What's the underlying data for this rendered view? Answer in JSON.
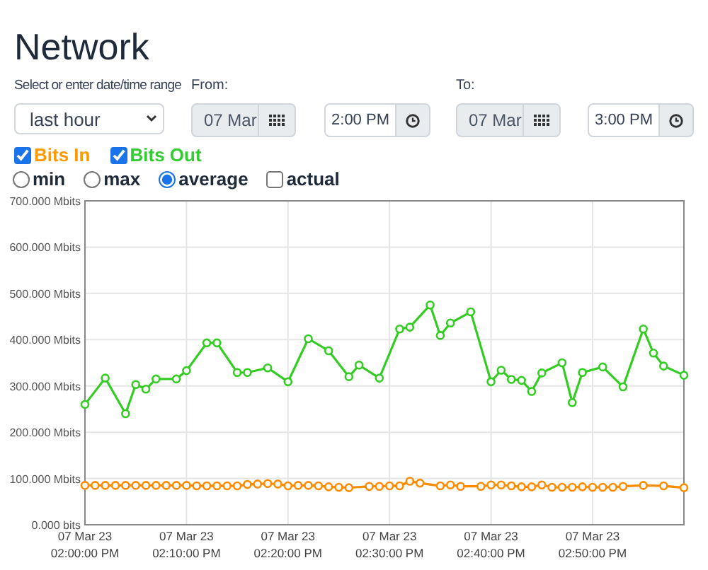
{
  "page": {
    "title": "Network"
  },
  "range": {
    "label": "Select or enter date/time range",
    "value": "last hour"
  },
  "from": {
    "label": "From:",
    "date": "07 Mar",
    "time": "2:00 PM"
  },
  "to": {
    "label": "To:",
    "date": "07 Mar",
    "time": "3:00 PM"
  },
  "series_toggles": [
    {
      "label": "Bits In",
      "checked": true,
      "color": "#ff9900"
    },
    {
      "label": "Bits Out",
      "checked": true,
      "color": "#33cc33"
    }
  ],
  "modes": [
    {
      "kind": "radio",
      "label": "min",
      "selected": false
    },
    {
      "kind": "radio",
      "label": "max",
      "selected": false
    },
    {
      "kind": "radio",
      "label": "average",
      "selected": true
    },
    {
      "kind": "checkbox",
      "label": "actual",
      "checked": false
    }
  ],
  "chart_data": {
    "type": "line",
    "grid": true,
    "ylim": [
      0,
      700
    ],
    "yticks": [
      {
        "value": 0,
        "label": "0.000 bits"
      },
      {
        "value": 100,
        "label": "100.000 Mbits"
      },
      {
        "value": 200,
        "label": "200.000 Mbits"
      },
      {
        "value": 300,
        "label": "300.000 Mbits"
      },
      {
        "value": 400,
        "label": "400.000 Mbits"
      },
      {
        "value": 500,
        "label": "500.000 Mbits"
      },
      {
        "value": 600,
        "label": "600.000 Mbits"
      },
      {
        "value": 700,
        "label": "700.000 Mbits"
      }
    ],
    "categories": [
      "07 Mar 23\n02:00:00 PM",
      null,
      null,
      null,
      null,
      null,
      null,
      null,
      null,
      null,
      "07 Mar 23\n02:10:00 PM",
      null,
      null,
      null,
      null,
      null,
      null,
      null,
      null,
      null,
      "07 Mar 23\n02:20:00 PM",
      null,
      null,
      null,
      null,
      null,
      null,
      null,
      null,
      null,
      "07 Mar 23\n02:30:00 PM",
      null,
      null,
      null,
      null,
      null,
      null,
      null,
      null,
      null,
      "07 Mar 23\n02:40:00 PM",
      null,
      null,
      null,
      null,
      null,
      null,
      null,
      null,
      null,
      "07 Mar 23\n02:50:00 PM",
      null,
      null,
      null,
      null,
      null,
      null,
      null,
      null,
      null
    ],
    "series": [
      {
        "color": "#33cc22",
        "marker": "circle",
        "values": [
          260,
          null,
          317,
          null,
          240,
          303,
          293,
          315,
          null,
          315,
          333,
          null,
          393,
          393,
          null,
          329,
          329,
          null,
          339,
          null,
          309,
          null,
          402,
          null,
          376,
          null,
          320,
          345,
          null,
          317,
          null,
          423,
          427,
          null,
          475,
          409,
          436,
          null,
          460,
          null,
          309,
          334,
          314,
          312,
          288,
          328,
          null,
          350,
          264,
          329,
          null,
          341,
          null,
          298,
          null,
          423,
          371,
          343,
          null,
          323
        ]
      },
      {
        "color": "#ff8c00",
        "marker": "circle",
        "values": [
          85,
          85,
          85,
          85,
          85,
          85,
          85,
          85,
          85,
          85,
          85,
          84,
          84,
          84,
          84,
          84,
          87,
          88,
          89,
          88,
          84,
          85,
          85,
          84,
          82,
          81,
          80,
          null,
          83,
          83,
          84,
          84,
          94,
          90,
          null,
          84,
          86,
          83,
          null,
          83,
          86,
          86,
          84,
          82,
          82,
          86,
          81,
          81,
          81,
          82,
          81,
          81,
          81,
          83,
          null,
          85,
          null,
          84,
          null,
          80
        ]
      }
    ]
  }
}
